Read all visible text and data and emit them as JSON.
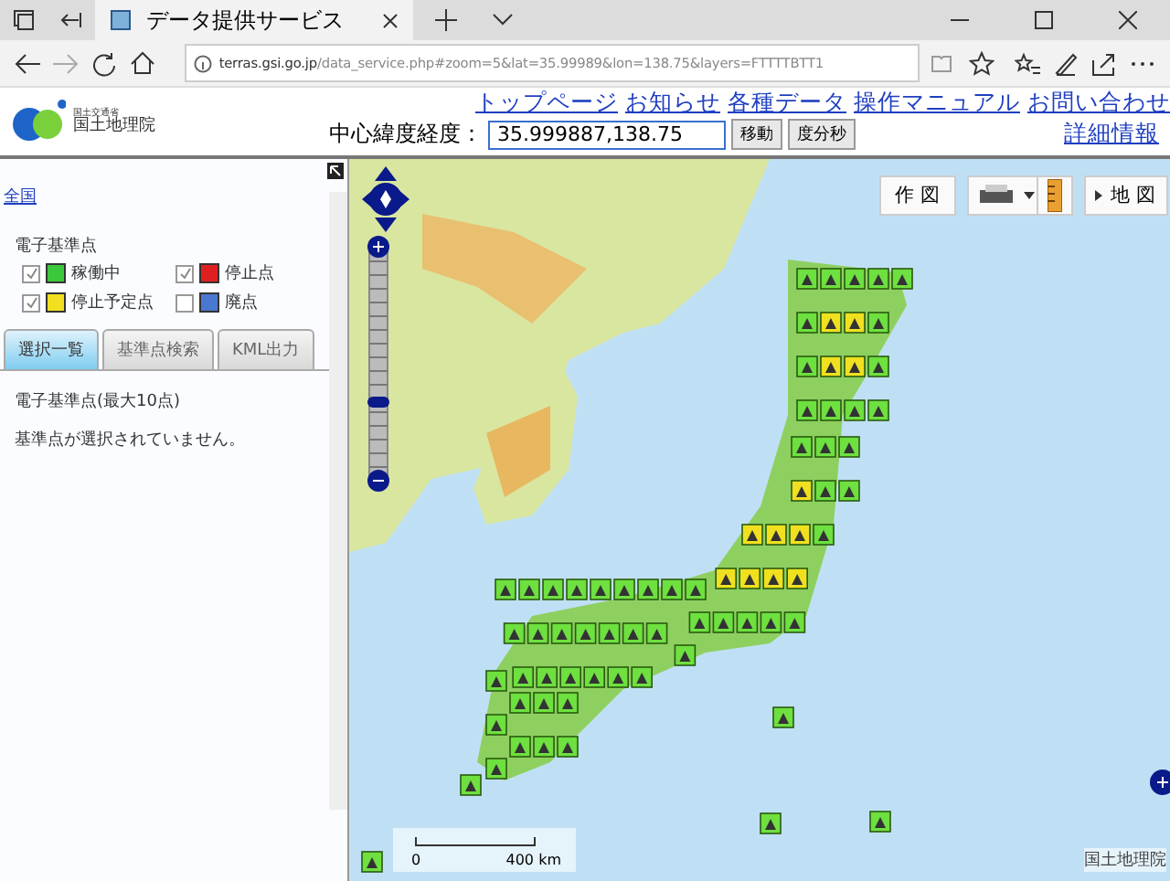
{
  "browser": {
    "tab_title": "データ提供サービス",
    "url_host": "terras.gsi.go.jp",
    "url_path": "/data_service.php#zoom=5&lat=35.99989&lon=138.75&layers=FTTTTBTT1"
  },
  "header": {
    "logo_small": "国土交通省",
    "logo_name": "国土地理院",
    "links": [
      "トップページ",
      "お知らせ",
      "各種データ",
      "操作マニュアル",
      "お問い合わせ"
    ],
    "coord_label": "中心緯度経度：",
    "coord_value": "35.999887,138.75",
    "buttons": [
      "移動",
      "度分秒"
    ],
    "detail_link": "詳細情報"
  },
  "sidebar": {
    "area_link": "全国",
    "legend_title": "電子基準点",
    "legend": [
      {
        "label": "稼働中",
        "checked": true,
        "color": "#3cc83c"
      },
      {
        "label": "停止点",
        "checked": true,
        "color": "#e02020"
      },
      {
        "label": "停止予定点",
        "checked": true,
        "color": "#f0e020"
      },
      {
        "label": "廃点",
        "checked": false,
        "color": "#4a78d0"
      }
    ],
    "tabs": [
      {
        "label": "選択一覧",
        "selected": true
      },
      {
        "label": "基準点検索",
        "selected": false
      },
      {
        "label": "KML出力",
        "selected": false
      }
    ],
    "list_title": "電子基準点(最大10点)",
    "empty_message": "基準点が選択されていません。"
  },
  "map": {
    "toolbar": {
      "draw_button": "作 図",
      "map_button": "地 図"
    },
    "scale": {
      "start": "0",
      "end": "400 km"
    },
    "attribution": "国土地理院"
  }
}
